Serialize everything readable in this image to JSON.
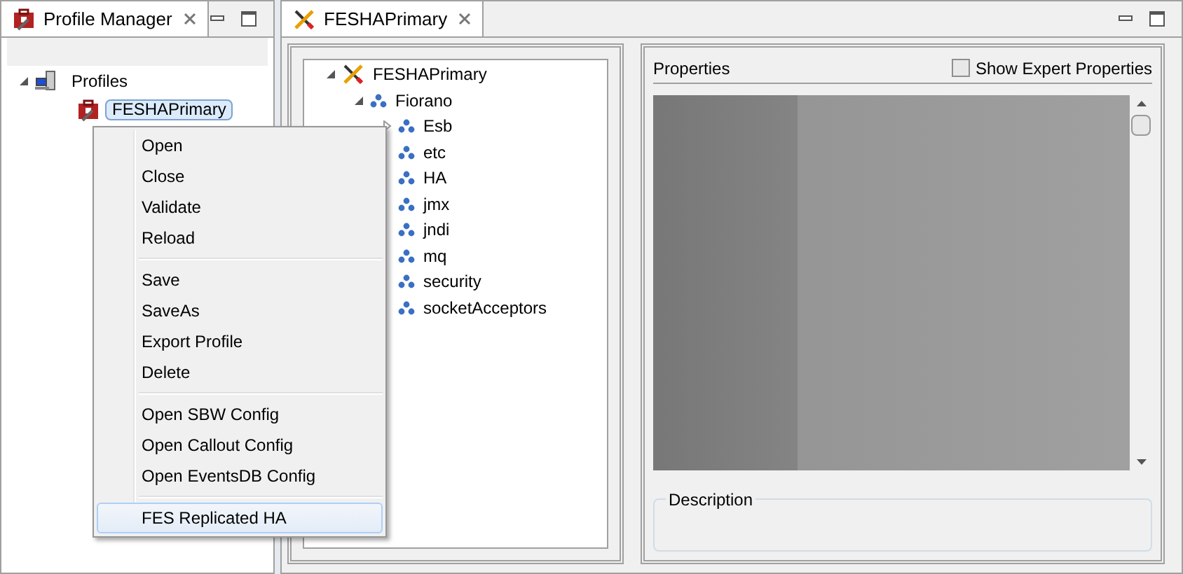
{
  "left_view": {
    "tab": {
      "title": "Profile Manager"
    },
    "tree": [
      {
        "label": "Profiles",
        "expanded": true,
        "children": [
          {
            "label": "FESHAPrimary",
            "selected": true
          }
        ]
      }
    ]
  },
  "editor": {
    "tab": {
      "title": "FESHAPrimary"
    },
    "tree": [
      {
        "label": "FESHAPrimary",
        "kind": "root",
        "expanded": true,
        "children": [
          {
            "label": "Fiorano",
            "kind": "folder",
            "expanded": true,
            "children": [
              {
                "label": "Esb",
                "kind": "folder",
                "expanded": false
              },
              {
                "label": "etc",
                "kind": "folder"
              },
              {
                "label": "HA",
                "kind": "folder"
              },
              {
                "label": "jmx",
                "kind": "folder"
              },
              {
                "label": "jndi",
                "kind": "folder"
              },
              {
                "label": "mq",
                "kind": "folder"
              },
              {
                "label": "security",
                "kind": "folder"
              },
              {
                "label": "socketAcceptors",
                "kind": "folder"
              }
            ]
          }
        ]
      }
    ],
    "properties": {
      "title": "Properties",
      "show_expert": {
        "label": "Show Expert Properties",
        "checked": false
      }
    },
    "description": {
      "title": "Description"
    }
  },
  "context_menu": {
    "groups": [
      [
        {
          "label": "Open",
          "selected": false
        },
        {
          "label": "Close",
          "selected": false
        },
        {
          "label": "Validate",
          "selected": false
        },
        {
          "label": "Reload",
          "selected": false
        }
      ],
      [
        {
          "label": "Save",
          "selected": false
        },
        {
          "label": "SaveAs",
          "selected": false
        },
        {
          "label": "Export Profile",
          "selected": false
        },
        {
          "label": "Delete",
          "selected": false
        }
      ],
      [
        {
          "label": "Open SBW Config",
          "selected": false
        },
        {
          "label": "Open Callout Config",
          "selected": false
        },
        {
          "label": "Open EventsDB Config",
          "selected": false
        }
      ],
      [
        {
          "label": "FES Replicated HA",
          "selected": true
        }
      ]
    ]
  }
}
